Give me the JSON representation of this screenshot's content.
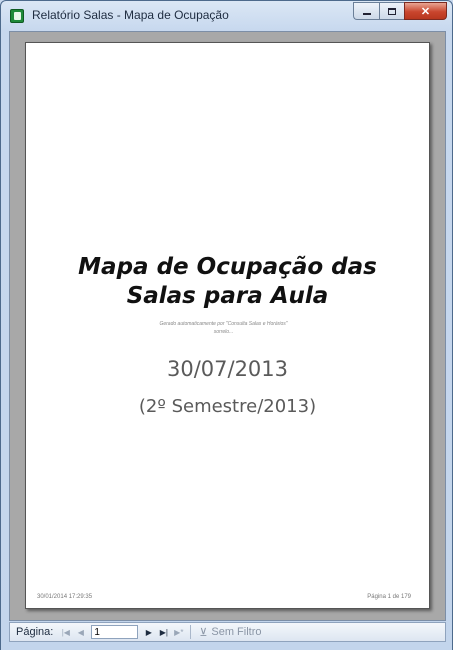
{
  "window": {
    "title": "Relatório Salas - Mapa de Ocupação",
    "min_symbol": "",
    "max_symbol": "",
    "close_symbol": "✕"
  },
  "report": {
    "title_line1": "Mapa de Ocupação das",
    "title_line2": "Salas para Aula",
    "note_line1": "Gerado automaticamente por \"Consulta Salas e Horários\"",
    "note_line2": "sorrelo...",
    "date": "30/07/2013",
    "semester": "(2º Semestre/2013)",
    "footer_timestamp": "30/01/2014 17:29:35",
    "footer_page": "Página 1 de 179"
  },
  "navbar": {
    "page_label": "Página:",
    "first_icon": "first-record-icon",
    "prev_icon": "prev-record-icon",
    "page_value": "1",
    "next_icon": "next-record-icon",
    "last_icon": "last-record-icon",
    "new_icon": "new-record-icon",
    "filter_label": "Sem Filtro"
  }
}
